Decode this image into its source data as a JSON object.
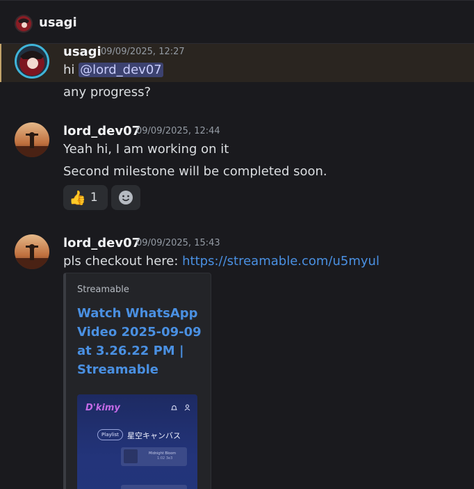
{
  "header": {
    "title": "usagi"
  },
  "messages": [
    {
      "author": "usagi",
      "timestamp": "09/09/2025, 12:27",
      "lines": [
        "hi ",
        "@lord_dev07"
      ],
      "extra_line": "any progress?"
    },
    {
      "author": "lord_dev07",
      "timestamp": "09/09/2025, 12:44",
      "line1": "Yeah hi, I am working on it",
      "line2": "Second milestone will be completed soon.",
      "reaction_emoji": "👍",
      "reaction_count": "1"
    },
    {
      "author": "lord_dev07",
      "timestamp": "09/09/2025, 15:43",
      "text_prefix": "pls checkout here: ",
      "link": "https://streamable.com/u5myul",
      "embed": {
        "provider": "Streamable",
        "title": "Watch WhatsApp Video 2025-09-09 at 3.26.22 PM | Streamable",
        "thumbnail": {
          "logo": "D'kimy",
          "pill": "Playlist",
          "heading": "星空キャンバス",
          "card_title": "Midnight Bloom",
          "card_sub": "1:02 3e3"
        }
      }
    }
  ],
  "colors": {
    "background": "#1a1a1e",
    "highlight": "#2a2520",
    "link": "#4a90e2",
    "mention": "#3c4270"
  }
}
